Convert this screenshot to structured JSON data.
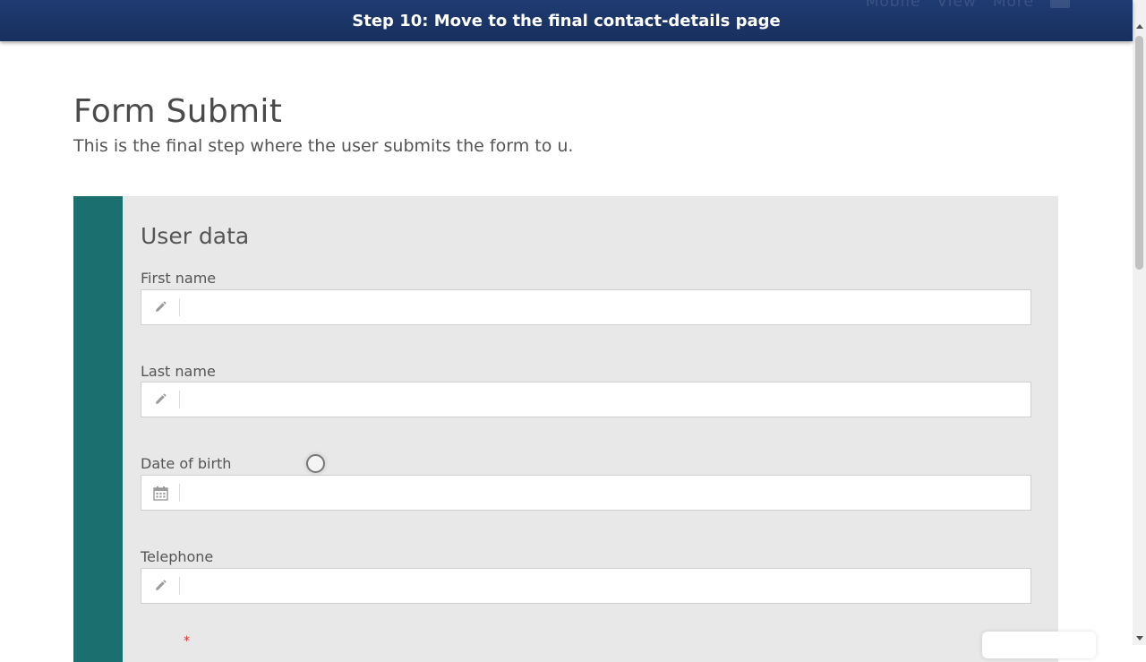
{
  "banner": {
    "step_text": "Step 10: Move to the final contact-details page"
  },
  "ghost_nav": {
    "items": [
      "Mobile",
      "View",
      "More"
    ]
  },
  "page": {
    "title": "Form Submit",
    "subtitle": "This is the final step where the user submits the form to u."
  },
  "form": {
    "section_title": "User data",
    "fields": [
      {
        "label": "First name",
        "icon": "pencil-icon",
        "value": ""
      },
      {
        "label": "Last name",
        "icon": "pencil-icon",
        "value": ""
      },
      {
        "label": "Date of birth",
        "icon": "calendar-icon",
        "value": ""
      },
      {
        "label": "Telephone",
        "icon": "pencil-icon",
        "value": ""
      }
    ],
    "required_mark": "*"
  },
  "colors": {
    "banner": "#1f3c72",
    "accent": "#1b706f",
    "card": "#e8e8e8",
    "required": "#d9342b"
  }
}
